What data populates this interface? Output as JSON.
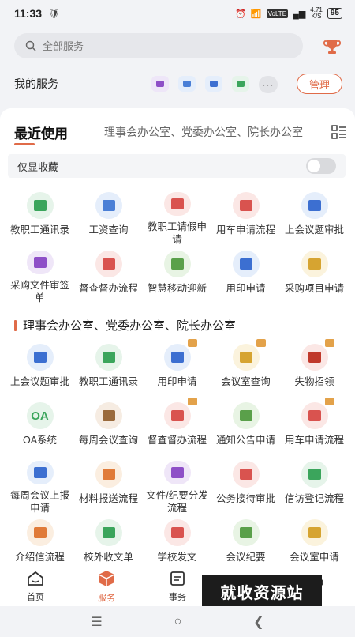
{
  "status_bar": {
    "time": "11:33",
    "net_speed_top": "4.71",
    "net_speed_bottom": "K/S",
    "battery": "95"
  },
  "search": {
    "placeholder": "全部服务"
  },
  "my_services": {
    "title": "我的服务",
    "more": "···",
    "manage_label": "管理"
  },
  "tabs": {
    "active": "最近使用",
    "other": "理事会办公室、党委办公室、院长办公室"
  },
  "favorites_only": {
    "label": "仅显收藏",
    "enabled": false
  },
  "recent_items": [
    {
      "label": "教职工通讯录",
      "color": "#e6f4ea",
      "glyph": "#3ba55c",
      "icon": "address-book-icon"
    },
    {
      "label": "工资查询",
      "color": "#e5eefb",
      "glyph": "#4a7fd6",
      "icon": "salary-icon"
    },
    {
      "label": "教职工请假申请",
      "color": "#fbe7e5",
      "glyph": "#d9534f",
      "icon": "leave-icon"
    },
    {
      "label": "用车申请流程",
      "color": "#fbe7e5",
      "glyph": "#d9534f",
      "icon": "car-icon"
    },
    {
      "label": "上会议题审批",
      "color": "#e5eefb",
      "glyph": "#3c6fd1",
      "icon": "meeting-topic-icon"
    },
    {
      "label": "采购文件审签单",
      "color": "#efe6f8",
      "glyph": "#8e4fc7",
      "icon": "mail-icon"
    },
    {
      "label": "督查督办流程",
      "color": "#fbe7e5",
      "glyph": "#d9534f",
      "icon": "supervise-icon"
    },
    {
      "label": "智慧移动迎新",
      "color": "#e8f4e4",
      "glyph": "#5aa04a",
      "icon": "welcome-icon"
    },
    {
      "label": "用印申请",
      "color": "#e5eefb",
      "glyph": "#3c6fd1",
      "icon": "seal-icon"
    },
    {
      "label": "采购项目申请",
      "color": "#fbf3dd",
      "glyph": "#d6a431",
      "icon": "purchase-icon"
    }
  ],
  "section": {
    "title": "理事会办公室、党委办公室、院长办公室"
  },
  "section_items": [
    {
      "label": "上会议题审批",
      "color": "#e5eefb",
      "glyph": "#3c6fd1",
      "icon": "meeting-topic-icon",
      "badge": false
    },
    {
      "label": "教职工通讯录",
      "color": "#e6f4ea",
      "glyph": "#3ba55c",
      "icon": "address-book-icon",
      "badge": false
    },
    {
      "label": "用印申请",
      "color": "#e5eefb",
      "glyph": "#3c6fd1",
      "icon": "seal-icon",
      "badge": true
    },
    {
      "label": "会议室查询",
      "color": "#fbf3dd",
      "glyph": "#d6a431",
      "icon": "meeting-room-icon",
      "badge": true
    },
    {
      "label": "失物招领",
      "color": "#fbe7e5",
      "glyph": "#c0392b",
      "icon": "lost-found-icon",
      "badge": true
    },
    {
      "label": "OA系统",
      "color": "#e6f4ea",
      "glyph": "#3ba55c",
      "icon": "oa-icon",
      "badge": false,
      "text": "OA"
    },
    {
      "label": "每周会议查询",
      "color": "#f6ece2",
      "glyph": "#9a6a3c",
      "icon": "money-bag-icon",
      "badge": false
    },
    {
      "label": "督查督办流程",
      "color": "#fbe7e5",
      "glyph": "#d9534f",
      "icon": "supervise-icon",
      "badge": true
    },
    {
      "label": "通知公告申请",
      "color": "#e8f4e4",
      "glyph": "#5aa04a",
      "icon": "speaker-icon",
      "badge": false
    },
    {
      "label": "用车申请流程",
      "color": "#fbe7e5",
      "glyph": "#d9534f",
      "icon": "car-icon",
      "badge": true
    },
    {
      "label": "每周会议上报申请",
      "color": "#e5eefb",
      "glyph": "#3c6fd1",
      "icon": "chart-icon",
      "badge": false
    },
    {
      "label": "材料报送流程",
      "color": "#fbeee0",
      "glyph": "#e07b39",
      "icon": "folder-icon",
      "badge": false
    },
    {
      "label": "文件/纪要分发流程",
      "color": "#efe6f8",
      "glyph": "#8e4fc7",
      "icon": "distribute-icon",
      "badge": false
    },
    {
      "label": "公务接待审批",
      "color": "#fbe7e5",
      "glyph": "#d9534f",
      "icon": "reception-icon",
      "badge": false
    },
    {
      "label": "信访登记流程",
      "color": "#e6f4ea",
      "glyph": "#3ba55c",
      "icon": "visit-icon",
      "badge": false
    },
    {
      "label": "介绍信流程",
      "color": "#fbeee0",
      "glyph": "#e07b39",
      "icon": "letter-icon",
      "badge": false
    },
    {
      "label": "校外收文单",
      "color": "#e6f4ea",
      "glyph": "#3ba55c",
      "icon": "inbox-doc-icon",
      "badge": false
    },
    {
      "label": "学校发文",
      "color": "#fbe7e5",
      "glyph": "#d9534f",
      "icon": "send-doc-icon",
      "badge": false
    },
    {
      "label": "会议纪要",
      "color": "#e8f4e4",
      "glyph": "#5aa04a",
      "icon": "minutes-icon",
      "badge": false
    },
    {
      "label": "会议室申请",
      "color": "#fbf3dd",
      "glyph": "#d6a431",
      "icon": "meeting-room-apply-icon",
      "badge": false
    }
  ],
  "bottom_nav": [
    {
      "label": "首页",
      "icon": "home-icon",
      "active": false
    },
    {
      "label": "服务",
      "icon": "services-cube-icon",
      "active": true
    },
    {
      "label": "事务",
      "icon": "tasks-icon",
      "active": false
    },
    {
      "label": "",
      "icon": "calendar-icon",
      "active": false
    },
    {
      "label": "",
      "icon": "profile-icon",
      "active": false
    }
  ],
  "watermark": "就收资源站",
  "colors": {
    "accent": "#e06b48",
    "background": "#f2f3f6"
  }
}
